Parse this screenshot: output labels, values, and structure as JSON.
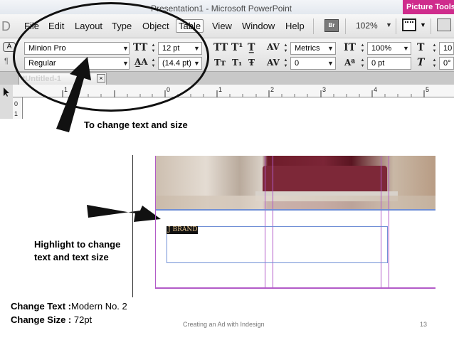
{
  "ppt": {
    "title": "Presentation1 - Microsoft PowerPoint",
    "picture_tools": "Picture Tools"
  },
  "menu": {
    "items": [
      "File",
      "Edit",
      "Layout",
      "Type",
      "Object",
      "Table",
      "View",
      "Window",
      "Help"
    ],
    "br_label": "Br",
    "zoom": "102%"
  },
  "control_panel": {
    "font_family": "Minion Pro",
    "font_style": "Regular",
    "font_size": "12 pt",
    "leading": "(14.4 pt)",
    "kerning": "Metrics",
    "tracking": "0",
    "vertical_scale": "100%",
    "baseline_shift": "0 pt",
    "horizontal_scale": "10",
    "skew": "0°"
  },
  "document": {
    "tab_label": "*Untitled-1",
    "tab_close": "×",
    "ruler_numbers": [
      "1",
      "0",
      "1",
      "2",
      "3",
      "4",
      "5"
    ],
    "vertical_ruler": [
      "0",
      "1"
    ]
  },
  "annotations": {
    "change_text_size": "To change text and size",
    "highlight_line1": "Highlight to change",
    "highlight_line2": "text  and text size"
  },
  "layout": {
    "brand_text": "J BRAND"
  },
  "instructions": {
    "change_text_label": "Change Text :",
    "change_text_value": "Modern No. 2",
    "change_size_label": "Change Size :",
    "change_size_value": " 72pt"
  },
  "footer": {
    "title": "Creating an Ad with Indesign",
    "page": "13"
  },
  "colors": {
    "picture_tools": "#cf2c8c",
    "guide": "#b25bc8",
    "frame": "#6f8fd6"
  }
}
